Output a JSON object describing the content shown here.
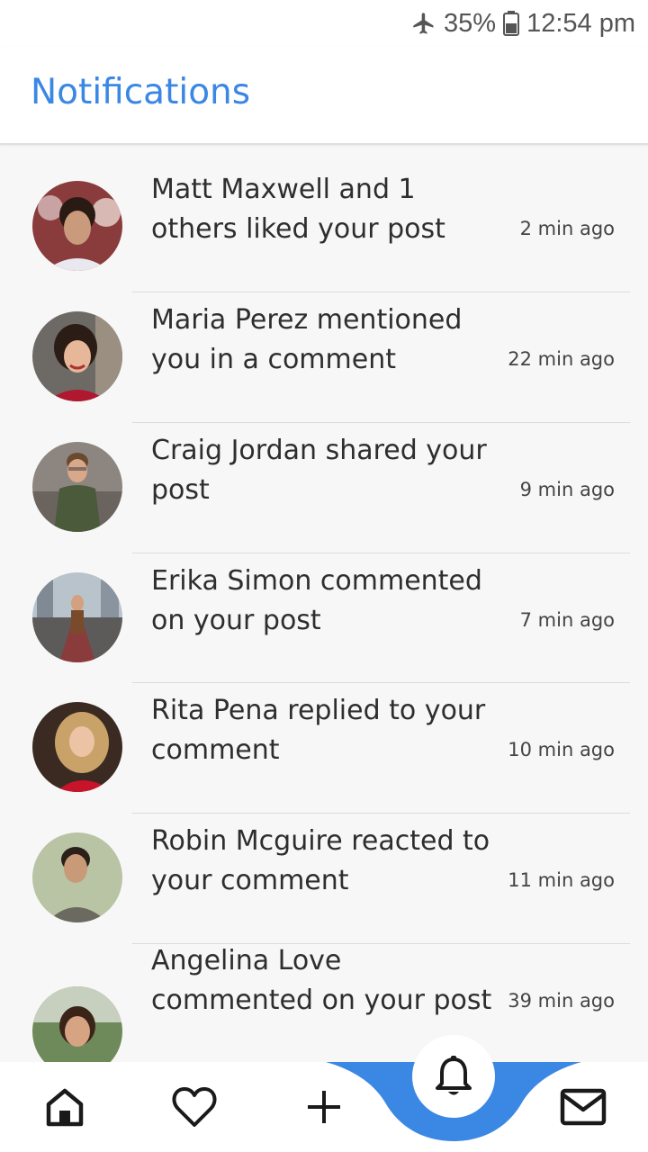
{
  "status_bar": {
    "battery": "35%",
    "time": "12:54 pm",
    "icons": [
      "airplane-icon",
      "battery-icon"
    ]
  },
  "header": {
    "title": "Notifications"
  },
  "accent_color": "#3b87e4",
  "notifications": [
    {
      "message": "Matt Maxwell and 1 others liked your post",
      "time": "2 min ago"
    },
    {
      "message": "Maria Perez mentioned you in a comment",
      "time": "22 min ago"
    },
    {
      "message": "Craig Jordan shared your post",
      "time": "9 min ago"
    },
    {
      "message": "Erika Simon commented on your post",
      "time": "7 min ago"
    },
    {
      "message": "Rita Pena replied to your comment",
      "time": "10 min ago"
    },
    {
      "message": "Robin Mcguire reacted to your comment",
      "time": "11 min ago"
    },
    {
      "message": "Angelina Love commented on your post",
      "time": "39 min ago"
    }
  ],
  "bottom_nav": {
    "items": [
      "home-icon",
      "heart-icon",
      "plus-icon",
      "bell-icon",
      "mail-icon"
    ],
    "active": "bell-icon"
  }
}
